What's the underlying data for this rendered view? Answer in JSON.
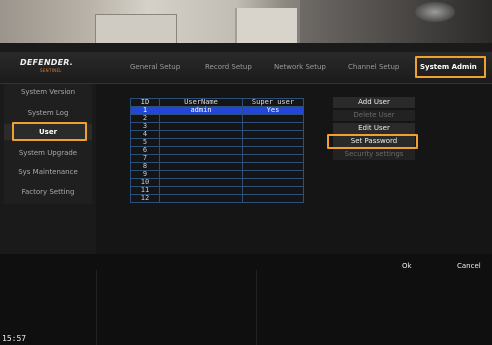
{
  "logo": {
    "brand": "DEFENDER.",
    "tagline": "SENTINEL"
  },
  "tabs": [
    {
      "label": "General Setup",
      "active": false
    },
    {
      "label": "Record Setup",
      "active": false
    },
    {
      "label": "Network Setup",
      "active": false
    },
    {
      "label": "Channel Setup",
      "active": false
    },
    {
      "label": "System Admin",
      "active": true
    }
  ],
  "sidebar": {
    "items": [
      {
        "label": "System Version"
      },
      {
        "label": "System Log"
      },
      {
        "label": "User",
        "active": true
      },
      {
        "label": "System Upgrade"
      },
      {
        "label": "Sys Maintenance"
      },
      {
        "label": "Factory Setting"
      }
    ]
  },
  "user_table": {
    "headers": [
      "ID",
      "UserName",
      "Super user"
    ],
    "rows": [
      {
        "id": "1",
        "username": "admin",
        "super": "Yes",
        "selected": true
      },
      {
        "id": "2",
        "username": "",
        "super": ""
      },
      {
        "id": "3",
        "username": "",
        "super": ""
      },
      {
        "id": "4",
        "username": "",
        "super": ""
      },
      {
        "id": "5",
        "username": "",
        "super": ""
      },
      {
        "id": "6",
        "username": "",
        "super": ""
      },
      {
        "id": "7",
        "username": "",
        "super": ""
      },
      {
        "id": "8",
        "username": "",
        "super": ""
      },
      {
        "id": "9",
        "username": "",
        "super": ""
      },
      {
        "id": "10",
        "username": "",
        "super": ""
      },
      {
        "id": "11",
        "username": "",
        "super": ""
      },
      {
        "id": "12",
        "username": "",
        "super": ""
      }
    ]
  },
  "actions": {
    "add_user": "Add User",
    "delete_user": "Delete User",
    "edit_user": "Edit User",
    "set_password": "Set Password",
    "security_settings": "Security settings"
  },
  "footer": {
    "ok": "Ok",
    "cancel": "Cancel",
    "time": "15:57"
  },
  "colors": {
    "highlight": "#f0a030",
    "selected_row": "#2345d8",
    "table_border": "#2c4f7a"
  }
}
